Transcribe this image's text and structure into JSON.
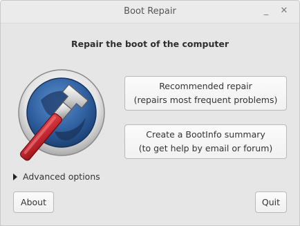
{
  "window": {
    "title": "Boot Repair",
    "minimize_glyph": "_",
    "close_glyph": "✕"
  },
  "main": {
    "heading": "Repair the boot of the computer",
    "logo_icon": "boot-repair-wrench-logo",
    "recommended_button": {
      "line1": "Recommended repair",
      "line2": "(repairs most frequent problems)"
    },
    "bootinfo_button": {
      "line1": "Create a BootInfo summary",
      "line2": "(to get help by email or forum)"
    },
    "advanced_options_label": "Advanced options"
  },
  "footer": {
    "about_label": "About",
    "quit_label": "Quit"
  },
  "colors": {
    "window_bg": "#e6e6e6",
    "logo_blue": "#2f5f9e",
    "wrench_red": "#c8202a",
    "wrench_silver": "#d8d8d8"
  }
}
